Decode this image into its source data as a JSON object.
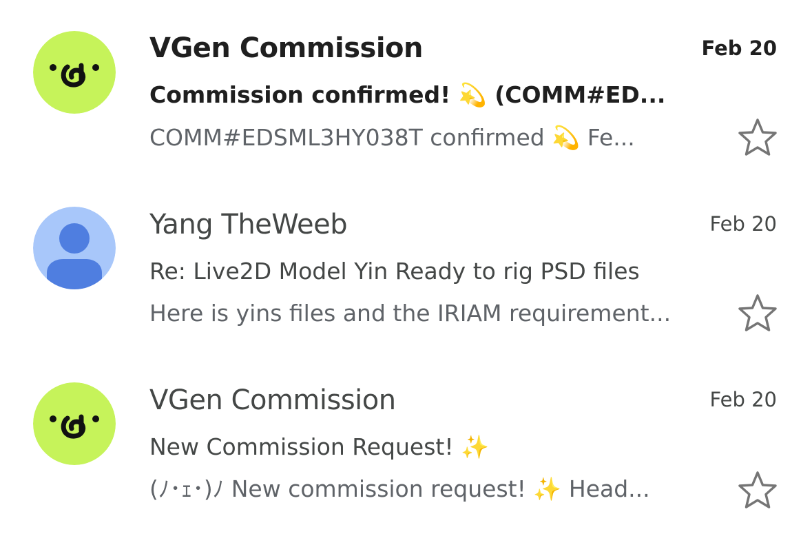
{
  "emails": [
    {
      "avatar": "vgen-logo-icon",
      "avatar_color": "#c6f35a",
      "sender": "VGen Commission",
      "date": "Feb 20",
      "subject": "Commission confirmed! 💫 (COMM#ED...",
      "snippet": "COMM#EDSML3HY038T confirmed 💫 Fe...",
      "unread": true,
      "starred": false
    },
    {
      "avatar": "person-icon",
      "avatar_color": "#a8c7fa",
      "sender": "Yang TheWeeb",
      "date": "Feb 20",
      "subject": "Re: Live2D Model Yin Ready to rig PSD files",
      "snippet": "Here is yins files and the IRIAM requirement...",
      "unread": false,
      "starred": false
    },
    {
      "avatar": "vgen-logo-icon",
      "avatar_color": "#c6f35a",
      "sender": "VGen Commission",
      "date": "Feb 20",
      "subject": "New Commission Request! ✨",
      "snippet": "(ﾉ･ｪ･)ﾉ New commission request! ✨ Head...",
      "unread": false,
      "starred": false
    }
  ]
}
